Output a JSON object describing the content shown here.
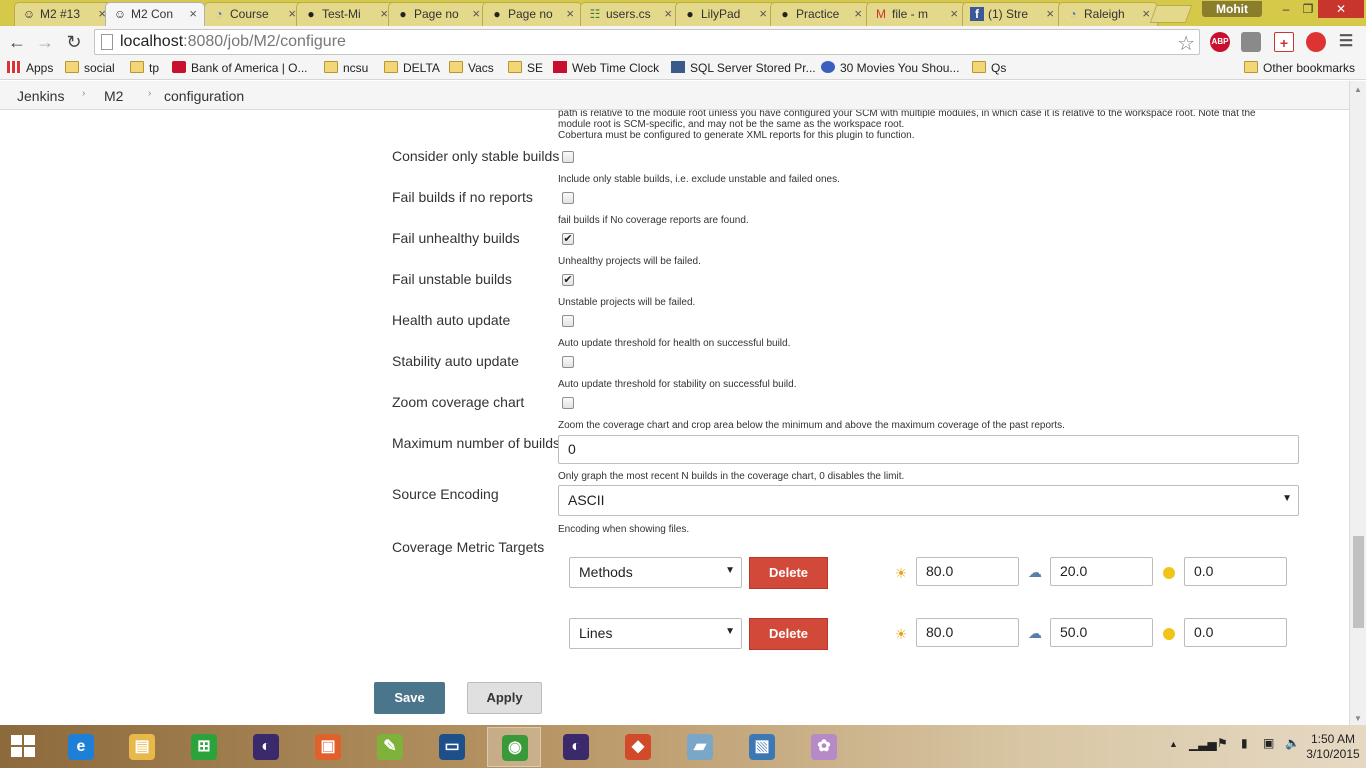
{
  "browser": {
    "tabs": [
      {
        "label": "M2 #13",
        "icon": "jenkins-icon"
      },
      {
        "label": "M2 Con",
        "icon": "jenkins-icon",
        "active": true
      },
      {
        "label": "Course",
        "icon": "loading-icon"
      },
      {
        "label": "Test-Mi",
        "icon": "github-icon"
      },
      {
        "label": "Page no",
        "icon": "github-icon"
      },
      {
        "label": "Page no",
        "icon": "github-icon"
      },
      {
        "label": "users.cs",
        "icon": "csv-icon"
      },
      {
        "label": "LilyPad",
        "icon": "github-icon"
      },
      {
        "label": "Practice",
        "icon": "github-icon"
      },
      {
        "label": "file - m",
        "icon": "gmail-icon"
      },
      {
        "label": "(1) Stre",
        "icon": "facebook-icon"
      },
      {
        "label": "Raleigh",
        "icon": "loading-icon"
      }
    ],
    "profile_name": "Mohit",
    "url_host": "localhost",
    "url_path": ":8080/job/M2/configure",
    "extensions": [
      "ABP"
    ],
    "bookmarks": [
      {
        "label": "Apps",
        "icon": "apps-icon"
      },
      {
        "label": "social",
        "icon": "folder-icon"
      },
      {
        "label": "tp",
        "icon": "folder-icon"
      },
      {
        "label": "Bank of America | O...",
        "icon": "bofa-icon"
      },
      {
        "label": "ncsu",
        "icon": "folder-icon"
      },
      {
        "label": "DELTA",
        "icon": "folder-icon"
      },
      {
        "label": "Vacs",
        "icon": "folder-icon"
      },
      {
        "label": "SE",
        "icon": "folder-icon"
      },
      {
        "label": "Web Time Clock",
        "icon": "webclock-icon"
      },
      {
        "label": "SQL Server Stored Pr...",
        "icon": "sql-icon"
      },
      {
        "label": "30 Movies You Shou...",
        "icon": "site-icon"
      },
      {
        "label": "Qs",
        "icon": "folder-icon"
      }
    ],
    "other_bookmarks": "Other bookmarks"
  },
  "breadcrumb": [
    "Jenkins",
    "M2",
    "configuration"
  ],
  "form": {
    "top_desc_lines": [
      "path is relative to the module root unless you have configured your SCM with multiple modules, in which case it is relative to the workspace root. Note that the",
      "module root is SCM-specific, and may not be the same as the workspace root.",
      "Cobertura must be configured to generate XML reports for this plugin to function."
    ],
    "checkbox_fields": [
      {
        "label": "Consider only stable builds",
        "checked": false,
        "desc": "Include only stable builds, i.e. exclude unstable and failed ones."
      },
      {
        "label": "Fail builds if no reports",
        "checked": false,
        "desc": "fail builds if No coverage reports are found."
      },
      {
        "label": "Fail unhealthy builds",
        "checked": true,
        "desc": "Unhealthy projects will be failed."
      },
      {
        "label": "Fail unstable builds",
        "checked": true,
        "desc": "Unstable projects will be failed."
      },
      {
        "label": "Health auto update",
        "checked": false,
        "desc": "Auto update threshold for health on successful build."
      },
      {
        "label": "Stability auto update",
        "checked": false,
        "desc": "Auto update threshold for stability on successful build."
      },
      {
        "label": "Zoom coverage chart",
        "checked": false,
        "desc": "Zoom the coverage chart and crop area below the minimum and above the maximum coverage of the past reports."
      }
    ],
    "max_builds": {
      "label": "Maximum number of builds",
      "value": "0",
      "desc": "Only graph the most recent N builds in the coverage chart, 0 disables the limit."
    },
    "source_encoding": {
      "label": "Source Encoding",
      "value": "ASCII",
      "desc": "Encoding when showing files."
    },
    "coverage_targets": {
      "label": "Coverage Metric Targets",
      "delete_label": "Delete",
      "rows": [
        {
          "metric": "Methods",
          "healthy": "80.0",
          "unhealthy": "20.0",
          "unstable": "0.0"
        },
        {
          "metric": "Lines",
          "healthy": "80.0",
          "unhealthy": "50.0",
          "unstable": "0.0"
        }
      ]
    },
    "save_label": "Save",
    "apply_label": "Apply"
  },
  "taskbar": {
    "apps": [
      {
        "name": "ie-icon",
        "color": "#1e7fd6",
        "glyph": "e"
      },
      {
        "name": "file-explorer-icon",
        "color": "#e8b84a",
        "glyph": "▤"
      },
      {
        "name": "store-icon",
        "color": "#2aa33a",
        "glyph": "⊞"
      },
      {
        "name": "eclipse-icon",
        "color": "#3b2a6b",
        "glyph": "◐"
      },
      {
        "name": "office-icon",
        "color": "#e0612b",
        "glyph": "▣"
      },
      {
        "name": "notepad-icon",
        "color": "#7fb23a",
        "glyph": "✎"
      },
      {
        "name": "terminal-icon",
        "color": "#1d4f8a",
        "glyph": "▭"
      },
      {
        "name": "chrome-icon",
        "color": "#3a9a3a",
        "glyph": "◉"
      },
      {
        "name": "eclipse-icon-2",
        "color": "#3b2a6b",
        "glyph": "◐"
      },
      {
        "name": "git-icon",
        "color": "#d24a2a",
        "glyph": "◆"
      },
      {
        "name": "notes-icon",
        "color": "#7aa6c8",
        "glyph": "▰"
      },
      {
        "name": "photos-icon",
        "color": "#3c79b4",
        "glyph": "▧"
      },
      {
        "name": "paint-icon",
        "color": "#b58ac7",
        "glyph": "✿"
      }
    ],
    "time": "1:50 AM",
    "date": "3/10/2015"
  }
}
